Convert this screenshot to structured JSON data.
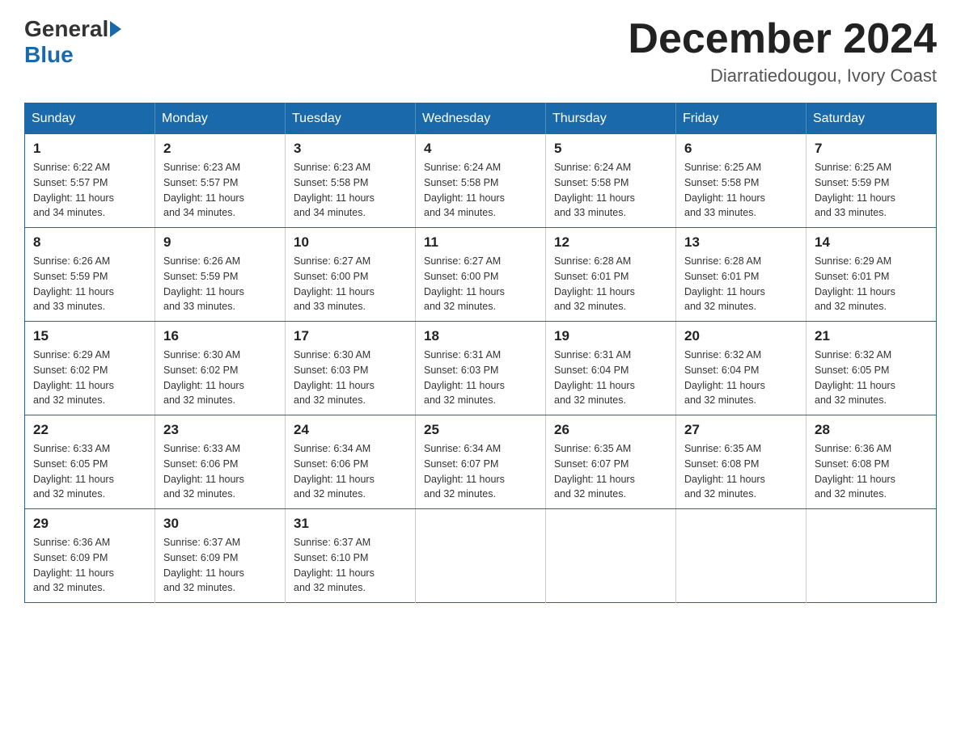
{
  "logo": {
    "general": "General",
    "blue": "Blue"
  },
  "title": "December 2024",
  "location": "Diarratiedougou, Ivory Coast",
  "days_of_week": [
    "Sunday",
    "Monday",
    "Tuesday",
    "Wednesday",
    "Thursday",
    "Friday",
    "Saturday"
  ],
  "weeks": [
    [
      {
        "day": "1",
        "sunrise": "6:22 AM",
        "sunset": "5:57 PM",
        "daylight": "11 hours and 34 minutes."
      },
      {
        "day": "2",
        "sunrise": "6:23 AM",
        "sunset": "5:57 PM",
        "daylight": "11 hours and 34 minutes."
      },
      {
        "day": "3",
        "sunrise": "6:23 AM",
        "sunset": "5:58 PM",
        "daylight": "11 hours and 34 minutes."
      },
      {
        "day": "4",
        "sunrise": "6:24 AM",
        "sunset": "5:58 PM",
        "daylight": "11 hours and 34 minutes."
      },
      {
        "day": "5",
        "sunrise": "6:24 AM",
        "sunset": "5:58 PM",
        "daylight": "11 hours and 33 minutes."
      },
      {
        "day": "6",
        "sunrise": "6:25 AM",
        "sunset": "5:58 PM",
        "daylight": "11 hours and 33 minutes."
      },
      {
        "day": "7",
        "sunrise": "6:25 AM",
        "sunset": "5:59 PM",
        "daylight": "11 hours and 33 minutes."
      }
    ],
    [
      {
        "day": "8",
        "sunrise": "6:26 AM",
        "sunset": "5:59 PM",
        "daylight": "11 hours and 33 minutes."
      },
      {
        "day": "9",
        "sunrise": "6:26 AM",
        "sunset": "5:59 PM",
        "daylight": "11 hours and 33 minutes."
      },
      {
        "day": "10",
        "sunrise": "6:27 AM",
        "sunset": "6:00 PM",
        "daylight": "11 hours and 33 minutes."
      },
      {
        "day": "11",
        "sunrise": "6:27 AM",
        "sunset": "6:00 PM",
        "daylight": "11 hours and 32 minutes."
      },
      {
        "day": "12",
        "sunrise": "6:28 AM",
        "sunset": "6:01 PM",
        "daylight": "11 hours and 32 minutes."
      },
      {
        "day": "13",
        "sunrise": "6:28 AM",
        "sunset": "6:01 PM",
        "daylight": "11 hours and 32 minutes."
      },
      {
        "day": "14",
        "sunrise": "6:29 AM",
        "sunset": "6:01 PM",
        "daylight": "11 hours and 32 minutes."
      }
    ],
    [
      {
        "day": "15",
        "sunrise": "6:29 AM",
        "sunset": "6:02 PM",
        "daylight": "11 hours and 32 minutes."
      },
      {
        "day": "16",
        "sunrise": "6:30 AM",
        "sunset": "6:02 PM",
        "daylight": "11 hours and 32 minutes."
      },
      {
        "day": "17",
        "sunrise": "6:30 AM",
        "sunset": "6:03 PM",
        "daylight": "11 hours and 32 minutes."
      },
      {
        "day": "18",
        "sunrise": "6:31 AM",
        "sunset": "6:03 PM",
        "daylight": "11 hours and 32 minutes."
      },
      {
        "day": "19",
        "sunrise": "6:31 AM",
        "sunset": "6:04 PM",
        "daylight": "11 hours and 32 minutes."
      },
      {
        "day": "20",
        "sunrise": "6:32 AM",
        "sunset": "6:04 PM",
        "daylight": "11 hours and 32 minutes."
      },
      {
        "day": "21",
        "sunrise": "6:32 AM",
        "sunset": "6:05 PM",
        "daylight": "11 hours and 32 minutes."
      }
    ],
    [
      {
        "day": "22",
        "sunrise": "6:33 AM",
        "sunset": "6:05 PM",
        "daylight": "11 hours and 32 minutes."
      },
      {
        "day": "23",
        "sunrise": "6:33 AM",
        "sunset": "6:06 PM",
        "daylight": "11 hours and 32 minutes."
      },
      {
        "day": "24",
        "sunrise": "6:34 AM",
        "sunset": "6:06 PM",
        "daylight": "11 hours and 32 minutes."
      },
      {
        "day": "25",
        "sunrise": "6:34 AM",
        "sunset": "6:07 PM",
        "daylight": "11 hours and 32 minutes."
      },
      {
        "day": "26",
        "sunrise": "6:35 AM",
        "sunset": "6:07 PM",
        "daylight": "11 hours and 32 minutes."
      },
      {
        "day": "27",
        "sunrise": "6:35 AM",
        "sunset": "6:08 PM",
        "daylight": "11 hours and 32 minutes."
      },
      {
        "day": "28",
        "sunrise": "6:36 AM",
        "sunset": "6:08 PM",
        "daylight": "11 hours and 32 minutes."
      }
    ],
    [
      {
        "day": "29",
        "sunrise": "6:36 AM",
        "sunset": "6:09 PM",
        "daylight": "11 hours and 32 minutes."
      },
      {
        "day": "30",
        "sunrise": "6:37 AM",
        "sunset": "6:09 PM",
        "daylight": "11 hours and 32 minutes."
      },
      {
        "day": "31",
        "sunrise": "6:37 AM",
        "sunset": "6:10 PM",
        "daylight": "11 hours and 32 minutes."
      },
      null,
      null,
      null,
      null
    ]
  ],
  "labels": {
    "sunrise": "Sunrise:",
    "sunset": "Sunset:",
    "daylight": "Daylight:"
  }
}
